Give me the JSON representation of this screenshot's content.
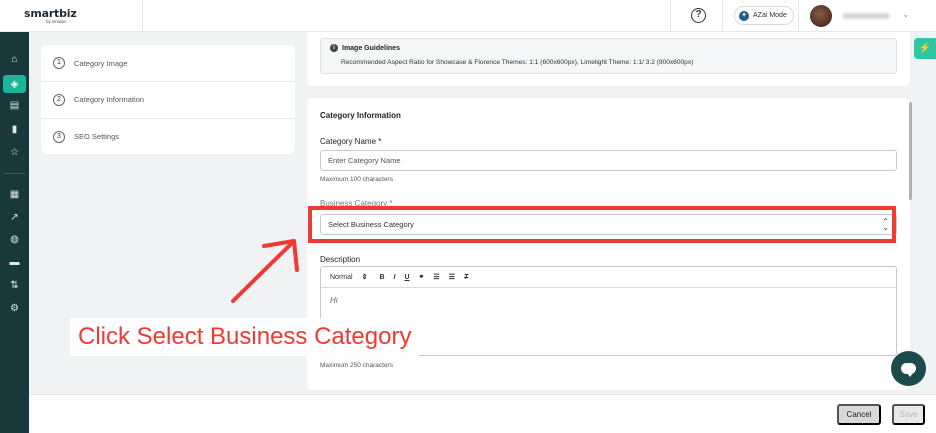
{
  "header": {
    "logo": "smartbiz",
    "logo_sub": "by amazon",
    "help_icon": "help-circle-icon",
    "azai_label": "AZai Mode",
    "user_chevron": "chevron-down-icon"
  },
  "sidebar": {
    "items": [
      {
        "icon": "home-icon",
        "glyph": "⌂"
      },
      {
        "icon": "cube-icon",
        "glyph": "◈",
        "active": true
      },
      {
        "icon": "clipboard-icon",
        "glyph": "▤"
      },
      {
        "icon": "bar-chart-icon",
        "glyph": "▮"
      },
      {
        "icon": "star-icon",
        "glyph": "☆"
      },
      {
        "icon": "store-icon",
        "glyph": "▦"
      },
      {
        "icon": "trending-up-icon",
        "glyph": "↗"
      },
      {
        "icon": "badge-icon",
        "glyph": "◍"
      },
      {
        "icon": "chat-icon",
        "glyph": "▬"
      },
      {
        "icon": "sort-icon",
        "glyph": "⇅"
      },
      {
        "icon": "settings-icon",
        "glyph": "⚙"
      }
    ]
  },
  "steps": [
    {
      "num": "1",
      "label": "Category Image"
    },
    {
      "num": "2",
      "label": "Category Information"
    },
    {
      "num": "3",
      "label": "SEO Settings"
    }
  ],
  "guidelines": {
    "title": "Image Guidelines",
    "text": "Recommended Aspect Ratio for Showcase & Florence Themes: 1:1 (600x600px), Limelight Theme: 1:1/ 3:2 (900x600px)"
  },
  "form": {
    "section_title": "Category Information",
    "name_label": "Category Name *",
    "name_placeholder": "Enter Category Name",
    "name_hint": "Maximum 100 characters",
    "business_label": "Business Category *",
    "business_placeholder": "Select Business Category",
    "description_label": "Description",
    "editor_format": "Normal",
    "editor_text": "Hi",
    "description_hint": "Maximum 250 characters"
  },
  "footer": {
    "cancel": "Cancel",
    "save": "Save"
  },
  "annotation": {
    "instruction": "Click Select Business Category",
    "color": "#ef3a34"
  }
}
